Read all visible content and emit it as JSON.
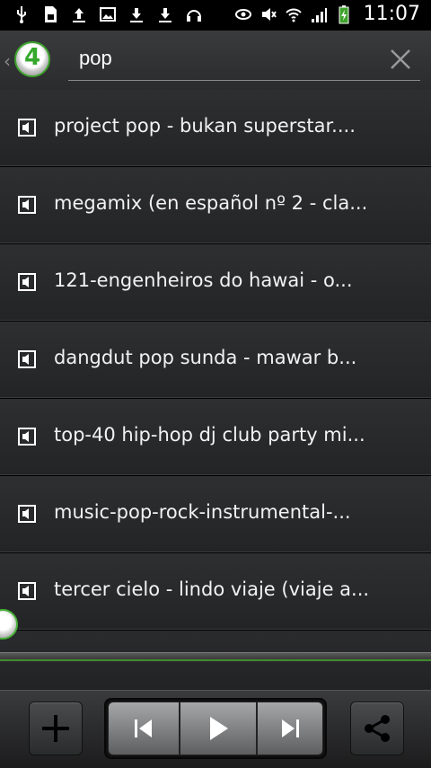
{
  "status_bar": {
    "time": "11:07",
    "left_icons": [
      "usb-icon",
      "sd-card-icon",
      "upload-icon",
      "image-icon",
      "download-icon",
      "download-icon",
      "headphones-icon"
    ],
    "right_icons": [
      "eye-icon",
      "mute-icon",
      "wifi-icon",
      "signal-icon",
      "battery-charging-icon"
    ]
  },
  "search": {
    "value": "pop",
    "placeholder": "",
    "logo_text": "4"
  },
  "results": [
    {
      "title": "project pop - bukan superstar...."
    },
    {
      "title": "megamix (en español nº 2 - cla..."
    },
    {
      "title": "121-engenheiros do hawai - o..."
    },
    {
      "title": "dangdut pop sunda - mawar b..."
    },
    {
      "title": "top-40 hip-hop dj club party mi..."
    },
    {
      "title": "music-pop-rock-instrumental-..."
    },
    {
      "title": "tercer cielo - lindo viaje (viaje a..."
    }
  ],
  "player": {
    "progress_fraction": 0.0
  },
  "colors": {
    "accent_green": "#3ea42d",
    "background": "#232426",
    "text": "#f2f2f2"
  }
}
